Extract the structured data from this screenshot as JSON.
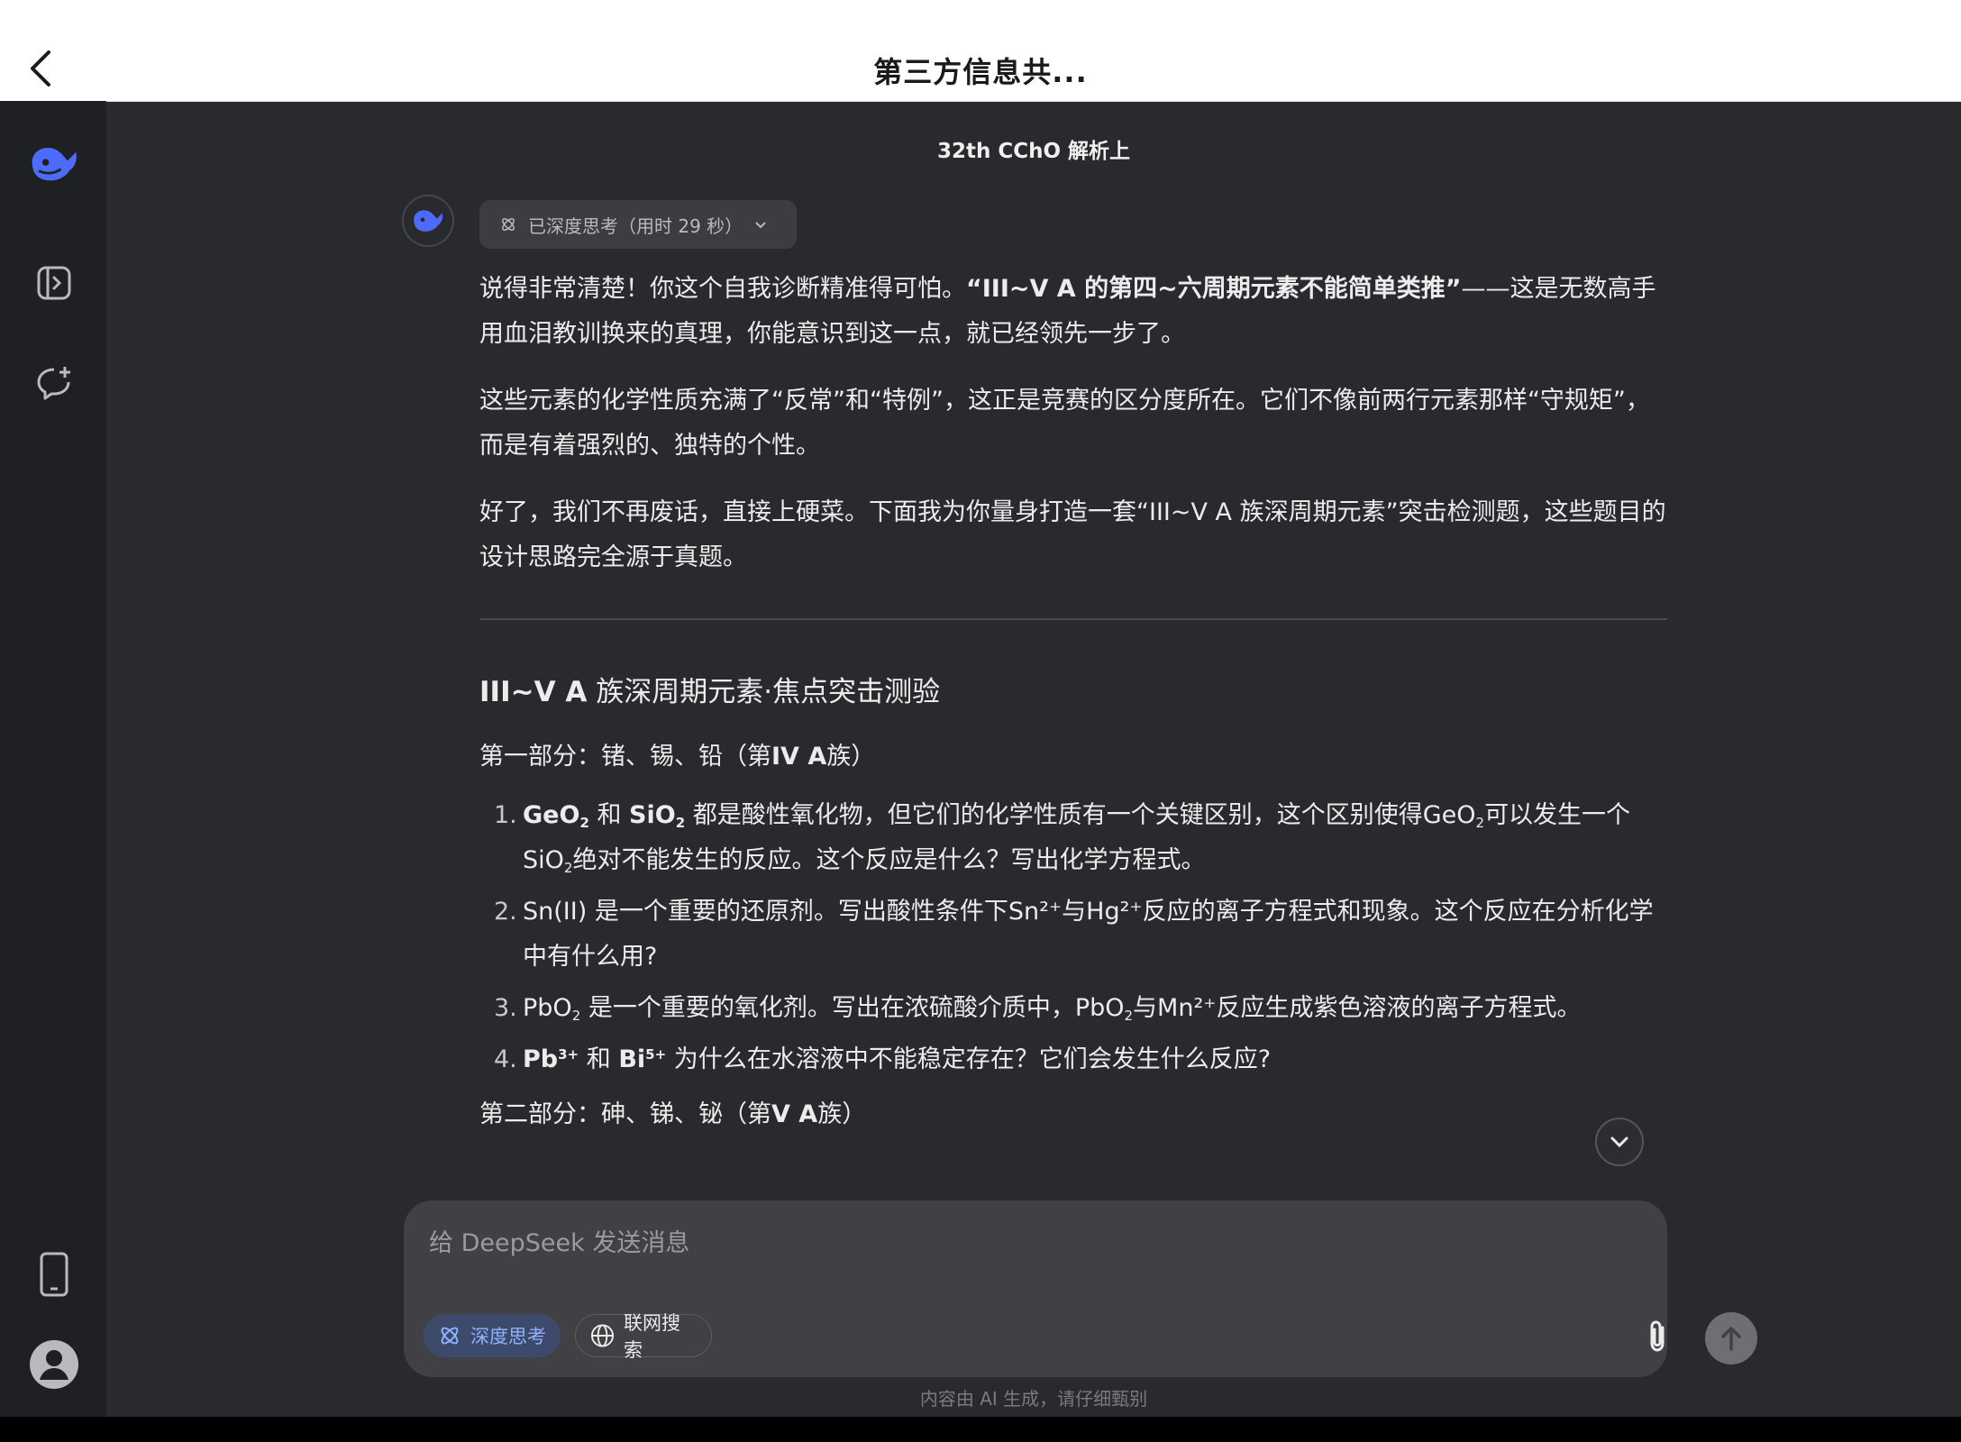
{
  "topbar": {
    "title": "第三方信息共..."
  },
  "conversation": {
    "title": "32th CChO 解析上",
    "thinking_label": "已深度思考（用时 29 秒）",
    "paragraphs": [
      {
        "pre": "说得非常清楚！你这个自我诊断精准得可怕。",
        "bold": "“III~V A 的第四~六周期元素不能简单类推”",
        "post": "——这是无数高手用血泪教训换来的真理，你能意识到这一点，就已经领先一步了。"
      },
      {
        "text": "这些元素的化学性质充满了“反常”和“特例”，这正是竞赛的区分度所在。它们不像前两行元素那样“守规矩”，而是有着强烈的、独特的个性。"
      },
      {
        "text": "好了，我们不再废话，直接上硬菜。下面我为你量身打造一套“III~V A 族深周期元素”突击检测题，这些题目的设计思路完全源于真题。"
      }
    ],
    "quiz_title_bold": "III~V A",
    "quiz_title_rest": " 族深周期元素·焦点突击测验",
    "part1": {
      "pre": "第一部分：锗、锡、铅（第",
      "bold": "IV A",
      "post": "族）"
    },
    "questions": [
      {
        "num": "1.",
        "b1": "GeO",
        "s1": "2",
        "t1": " 和 ",
        "b2": "SiO",
        "s2": "2",
        "t2": " 都是酸性氧化物，但它们的化学性质有一个关键区别，这个区别使得GeO",
        "s3": "2",
        "t3": "可以发生一个SiO",
        "s4": "2",
        "t4": "绝对不能发生的反应。这个反应是什么？写出化学方程式。"
      },
      {
        "num": "2.",
        "text": "Sn(II) 是一个重要的还原剂。写出酸性条件下Sn²⁺与Hg²⁺反应的离子方程式和现象。这个反应在分析化学中有什么用?"
      },
      {
        "num": "3.",
        "t1": "PbO",
        "s1": "2",
        "t2": " 是一个重要的氧化剂。写出在浓硫酸介质中，PbO",
        "s2": "2",
        "t3": "与Mn²⁺反应生成紫色溶液的离子方程式。"
      },
      {
        "num": "4.",
        "b1": "Pb",
        "p1": "3+",
        "t1": " 和 ",
        "b2": "Bi",
        "p2": "5+",
        "t2": " 为什么在水溶液中不能稳定存在？它们会发生什么反应?"
      }
    ],
    "part2": {
      "pre": "第二部分：砷、锑、铋（第",
      "bold": "V A",
      "post": "族）"
    }
  },
  "composer": {
    "placeholder": "给 DeepSeek 发送消息",
    "deep_think_label": "深度思考",
    "web_search_label": "联网搜索"
  },
  "disclaimer": "内容由 AI 生成，请仔细甄别",
  "colors": {
    "accent": "#4d6bfe",
    "chip_active_text": "#8fb1ff",
    "background": "#292a2d",
    "sidebar": "#1f2023"
  }
}
